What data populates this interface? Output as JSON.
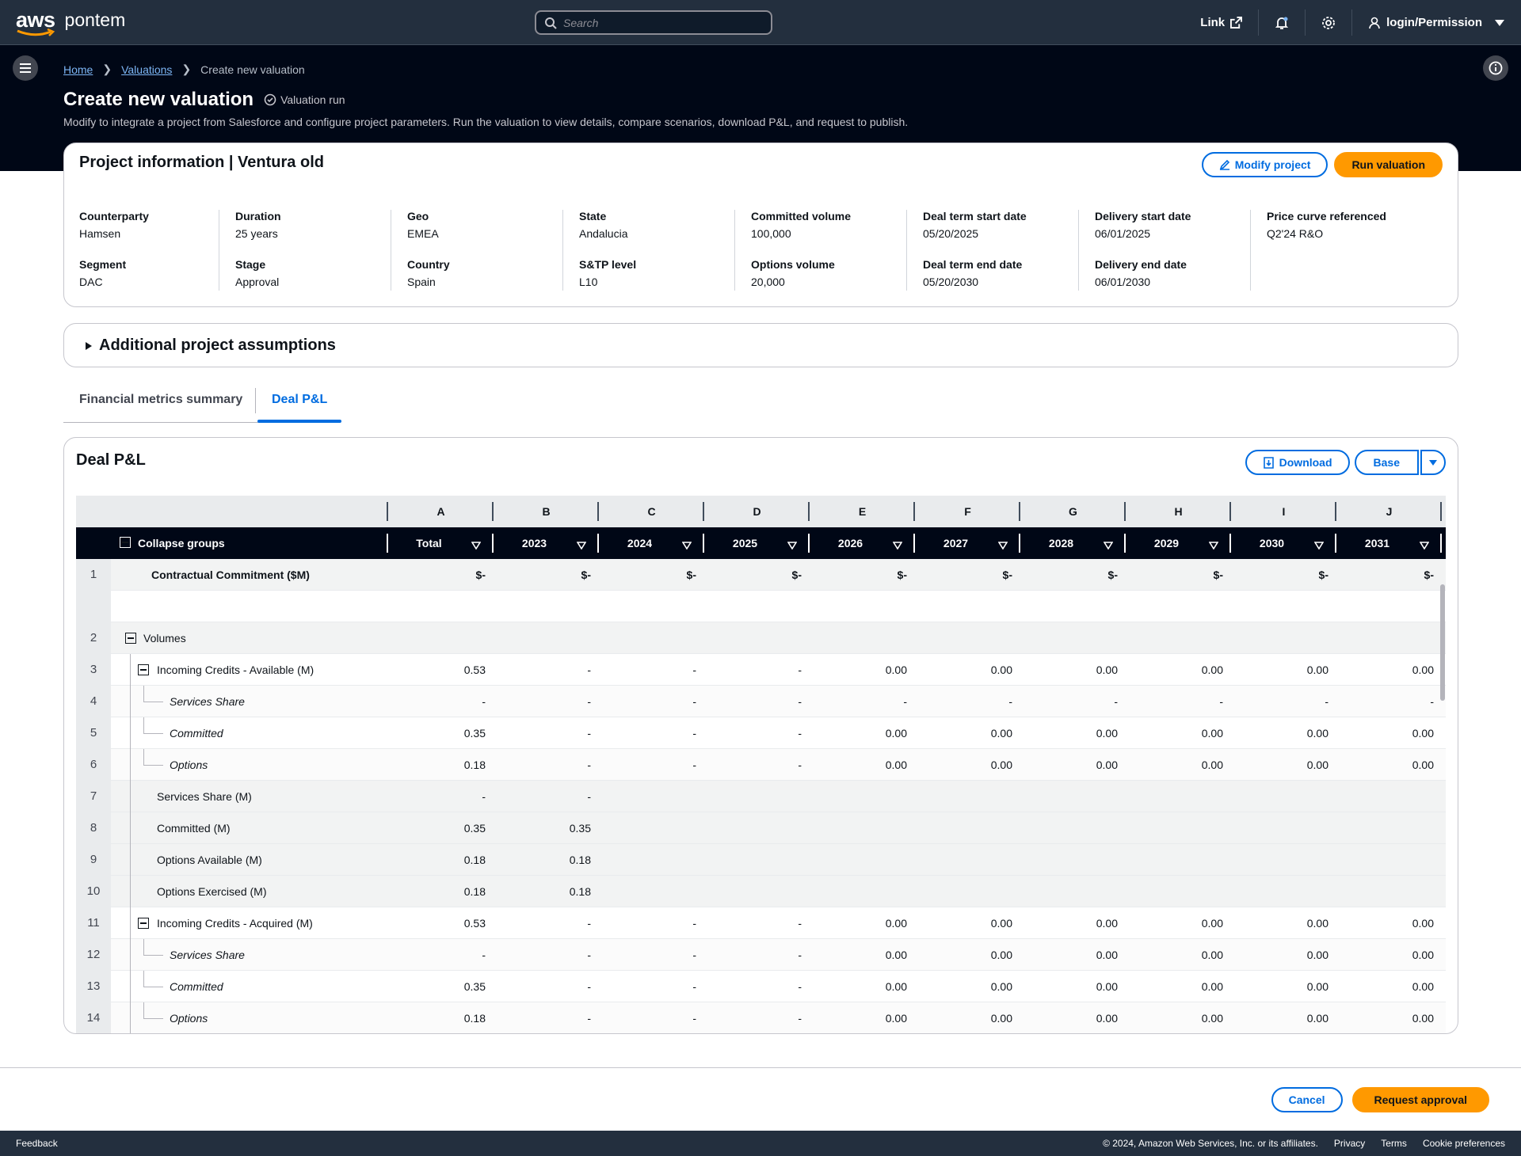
{
  "nav": {
    "brand": "aws",
    "product": "pontem",
    "search_placeholder": "Search",
    "link_label": "Link",
    "user_label": "login/Permission"
  },
  "breadcrumb": {
    "items": [
      "Home",
      "Valuations"
    ],
    "current": "Create new valuation"
  },
  "page": {
    "title": "Create new valuation",
    "status": "Valuation run",
    "description": "Modify to integrate a project from Salesforce and configure project parameters. Run the valuation to view details, compare scenarios, download P&L, and request to publish."
  },
  "project": {
    "title": "Project information | Ventura old",
    "modify_label": "Modify project",
    "run_label": "Run valuation",
    "fields": [
      {
        "k1": "Counterparty",
        "v1": "Hamsen",
        "k2": "Segment",
        "v2": "DAC"
      },
      {
        "k1": "Duration",
        "v1": "25 years",
        "k2": "Stage",
        "v2": "Approval"
      },
      {
        "k1": "Geo",
        "v1": "EMEA",
        "k2": "Country",
        "v2": "Spain"
      },
      {
        "k1": "State",
        "v1": "Andalucia",
        "k2": "S&TP level",
        "v2": "L10"
      },
      {
        "k1": "Committed volume",
        "v1": "100,000",
        "k2": "Options volume",
        "v2": "20,000"
      },
      {
        "k1": "Deal term start date",
        "v1": "05/20/2025",
        "k2": "Deal term end date",
        "v2": "05/20/2030"
      },
      {
        "k1": "Delivery start date",
        "v1": "06/01/2025",
        "k2": "Delivery end date",
        "v2": "06/01/2030"
      },
      {
        "k1": "Price curve referenced",
        "v1": "Q2'24 R&O",
        "k2": "",
        "v2": ""
      }
    ]
  },
  "assumptions": {
    "label": "Additional project assumptions"
  },
  "tabs": [
    {
      "label": "Financial metrics summary"
    },
    {
      "label": "Deal P&L"
    }
  ],
  "pl": {
    "title": "Deal P&L",
    "download_label": "Download",
    "scenario_label": "Base",
    "collapse_label": "Collapse groups",
    "letters": [
      "A",
      "B",
      "C",
      "D",
      "E",
      "F",
      "G",
      "H",
      "I",
      "J"
    ],
    "columns": [
      "Total",
      "2023",
      "2024",
      "2025",
      "2026",
      "2027",
      "2028",
      "2029",
      "2030",
      "2031"
    ],
    "rows": [
      {
        "num": "1",
        "label": "Contractual Commitment ($M)",
        "values": [
          "$-",
          "$-",
          "$-",
          "$-",
          "$-",
          "$-",
          "$-",
          "$-",
          "$-",
          "$-"
        ]
      },
      {
        "num": "",
        "label": "",
        "values": []
      },
      {
        "num": "2",
        "label": "Volumes",
        "values": []
      },
      {
        "num": "3",
        "label": "Incoming Credits - Available (M)",
        "values": [
          "0.53",
          "-",
          "-",
          "-",
          "0.00",
          "0.00",
          "0.00",
          "0.00",
          "0.00",
          "0.00"
        ]
      },
      {
        "num": "4",
        "label": "Services Share",
        "values": [
          "-",
          "-",
          "-",
          "-",
          "-",
          "-",
          "-",
          "-",
          "-",
          "-"
        ]
      },
      {
        "num": "5",
        "label": "Committed",
        "values": [
          "0.35",
          "-",
          "-",
          "-",
          "0.00",
          "0.00",
          "0.00",
          "0.00",
          "0.00",
          "0.00"
        ]
      },
      {
        "num": "6",
        "label": "Options",
        "values": [
          "0.18",
          "-",
          "-",
          "-",
          "0.00",
          "0.00",
          "0.00",
          "0.00",
          "0.00",
          "0.00"
        ]
      },
      {
        "num": "7",
        "label": "Services Share (M)",
        "values": [
          "-",
          "-"
        ]
      },
      {
        "num": "8",
        "label": "Committed (M)",
        "values": [
          "0.35",
          "0.35"
        ]
      },
      {
        "num": "9",
        "label": "Options Available (M)",
        "values": [
          "0.18",
          "0.18"
        ]
      },
      {
        "num": "10",
        "label": "Options Exercised (M)",
        "values": [
          "0.18",
          "0.18"
        ]
      },
      {
        "num": "11",
        "label": "Incoming Credits - Acquired (M)",
        "values": [
          "0.53",
          "-",
          "-",
          "-",
          "0.00",
          "0.00",
          "0.00",
          "0.00",
          "0.00",
          "0.00"
        ]
      },
      {
        "num": "12",
        "label": "Services Share",
        "values": [
          "-",
          "-",
          "-",
          "-",
          "0.00",
          "0.00",
          "0.00",
          "0.00",
          "0.00",
          "0.00"
        ]
      },
      {
        "num": "13",
        "label": "Committed",
        "values": [
          "0.35",
          "-",
          "-",
          "-",
          "0.00",
          "0.00",
          "0.00",
          "0.00",
          "0.00",
          "0.00"
        ]
      },
      {
        "num": "14",
        "label": "Options",
        "values": [
          "0.18",
          "-",
          "-",
          "-",
          "0.00",
          "0.00",
          "0.00",
          "0.00",
          "0.00",
          "0.00"
        ]
      }
    ]
  },
  "actions": {
    "cancel_label": "Cancel",
    "request_label": "Request approval"
  },
  "footer": {
    "feedback": "Feedback",
    "copyright": "© 2024, Amazon Web Services, Inc. or its affiliates.",
    "privacy": "Privacy",
    "terms": "Terms",
    "cookies": "Cookie preferences"
  }
}
